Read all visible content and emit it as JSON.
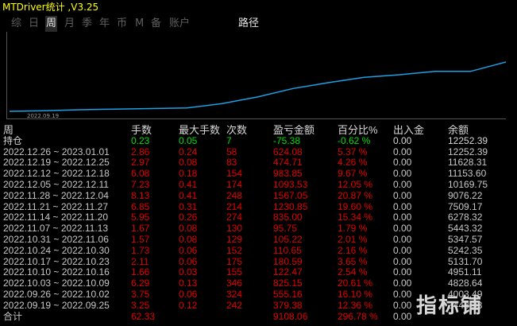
{
  "title": "MTDriver统计  ,V3.25",
  "tabs": [
    {
      "label": "综"
    },
    {
      "label": "日"
    },
    {
      "label": "周"
    },
    {
      "label": "月"
    },
    {
      "label": "季"
    },
    {
      "label": "年"
    },
    {
      "label": "币"
    },
    {
      "label": "M"
    },
    {
      "label": "备"
    },
    {
      "label": "账户"
    },
    {
      "label": "路径"
    }
  ],
  "active_tab": "周",
  "colors": {
    "line": "#1ea0e6",
    "red": "#e00000",
    "green": "#00e000",
    "title": "#ffff00"
  },
  "chart_data": {
    "type": "line",
    "x_label_first": "2022.09.19",
    "balance": [
      4828.64,
      4951.11,
      5131.7,
      5242.35,
      5347.57,
      5443.32,
      6278.32,
      7509.17,
      9076.22,
      10169.75,
      11153.6,
      11628.31,
      12252.39,
      12252.39,
      14000
    ]
  },
  "headers": [
    "周",
    "手数",
    "最大手数",
    "次数",
    "盈亏金额",
    "百分比%",
    "出入金",
    "余额"
  ],
  "holding": {
    "label": "持仓",
    "lots": "0.23",
    "max": "0.05",
    "count": "7",
    "pnl": "-75.38",
    "pct": "-0.62 %",
    "io": "0.00",
    "balance": "12252.39"
  },
  "rows": [
    {
      "period": "2022.12.26 ~ 2023.01.01",
      "lots": "2.86",
      "max": "0.24",
      "count": "58",
      "pnl": "624.08",
      "pct": "5.37 %",
      "io": "0.00",
      "balance": "12252.39"
    },
    {
      "period": "2022.12.19 ~ 2022.12.25",
      "lots": "2.97",
      "max": "0.08",
      "count": "83",
      "pnl": "474.71",
      "pct": "4.26 %",
      "io": "0.00",
      "balance": "11628.31"
    },
    {
      "period": "2022.12.12 ~ 2022.12.18",
      "lots": "6.08",
      "max": "0.18",
      "count": "154",
      "pnl": "983.85",
      "pct": "9.67 %",
      "io": "0.00",
      "balance": "11153.60"
    },
    {
      "period": "2022.12.05 ~ 2022.12.11",
      "lots": "7.23",
      "max": "0.41",
      "count": "174",
      "pnl": "1093.53",
      "pct": "12.05 %",
      "io": "0.00",
      "balance": "10169.75"
    },
    {
      "period": "2022.11.28 ~ 2022.12.04",
      "lots": "8.13",
      "max": "0.41",
      "count": "248",
      "pnl": "1567.05",
      "pct": "20.87 %",
      "io": "0.00",
      "balance": "9076.22"
    },
    {
      "period": "2022.11.21 ~ 2022.11.27",
      "lots": "6.85",
      "max": "0.31",
      "count": "214",
      "pnl": "1230.85",
      "pct": "19.60 %",
      "io": "0.00",
      "balance": "7509.17"
    },
    {
      "period": "2022.11.14 ~ 2022.11.20",
      "lots": "5.95",
      "max": "0.26",
      "count": "274",
      "pnl": "835.00",
      "pct": "15.34 %",
      "io": "0.00",
      "balance": "6278.32"
    },
    {
      "period": "2022.11.07 ~ 2022.11.13",
      "lots": "1.67",
      "max": "0.08",
      "count": "130",
      "pnl": "95.75",
      "pct": "1.79 %",
      "io": "0.00",
      "balance": "5443.32"
    },
    {
      "period": "2022.10.31 ~ 2022.11.06",
      "lots": "1.57",
      "max": "0.08",
      "count": "129",
      "pnl": "105.22",
      "pct": "2.01 %",
      "io": "0.00",
      "balance": "5347.57"
    },
    {
      "period": "2022.10.24 ~ 2022.10.30",
      "lots": "1.73",
      "max": "0.06",
      "count": "152",
      "pnl": "110.65",
      "pct": "2.16 %",
      "io": "0.00",
      "balance": "5242.35"
    },
    {
      "period": "2022.10.17 ~ 2022.10.23",
      "lots": "2.11",
      "max": "0.06",
      "count": "175",
      "pnl": "180.59",
      "pct": "3.65 %",
      "io": "0.00",
      "balance": "5131.70"
    },
    {
      "period": "2022.10.10 ~ 2022.10.16",
      "lots": "1.66",
      "max": "0.03",
      "count": "155",
      "pnl": "122.47",
      "pct": "2.54 %",
      "io": "0.00",
      "balance": "4951.11"
    },
    {
      "period": "2022.10.03 ~ 2022.10.09",
      "lots": "6.29",
      "max": "0.13",
      "count": "346",
      "pnl": "825.15",
      "pct": "20.61 %",
      "io": "0.00",
      "balance": "4828.64"
    },
    {
      "period": "2022.09.26 ~ 2022.10.02",
      "lots": "3.75",
      "max": "0.06",
      "count": "324",
      "pnl": "555.16",
      "pct": "16.10 %",
      "io": "0.00",
      "balance": "4003.49"
    },
    {
      "period": "2022.09.19 ~ 2022.09.25",
      "lots": "3.25",
      "max": "0.12",
      "count": "242",
      "pnl": "379.38",
      "pct": "12.36 %",
      "io": "0.00",
      "balance": "3448.33"
    }
  ],
  "total": {
    "label": "合计",
    "lots": "62.33",
    "pnl": "9108.06",
    "pct": "296.78 %",
    "io": "0.00"
  },
  "watermark": "指标铺"
}
